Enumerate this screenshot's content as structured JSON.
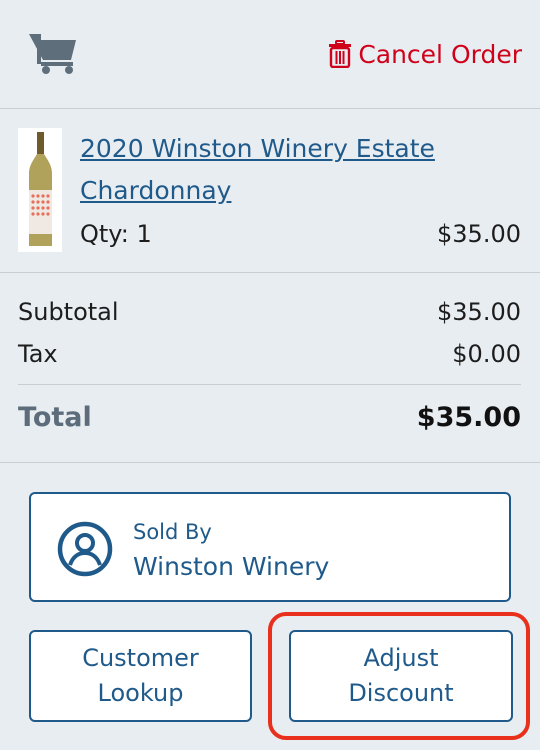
{
  "header": {
    "cart_icon": "shopping-cart-icon",
    "cancel_icon": "trash-icon",
    "cancel_label": "Cancel Order"
  },
  "item": {
    "name": "2020 Winston Winery Estate Chardonnay",
    "qty_label": "Qty: 1",
    "price": "$35.00"
  },
  "totals": {
    "subtotal_label": "Subtotal",
    "subtotal_value": "$35.00",
    "tax_label": "Tax",
    "tax_value": "$0.00",
    "total_label": "Total",
    "total_value": "$35.00"
  },
  "sold_by": {
    "icon": "user-circle-icon",
    "label": "Sold By",
    "value": "Winston Winery"
  },
  "actions": {
    "customer_lookup": "Customer\nLookup",
    "adjust_discount": "Adjust\nDiscount"
  },
  "colors": {
    "background": "#e8edf2",
    "link_blue": "#1f5a8a",
    "cancel_red": "#d0021b",
    "highlight": "#e8301c"
  }
}
